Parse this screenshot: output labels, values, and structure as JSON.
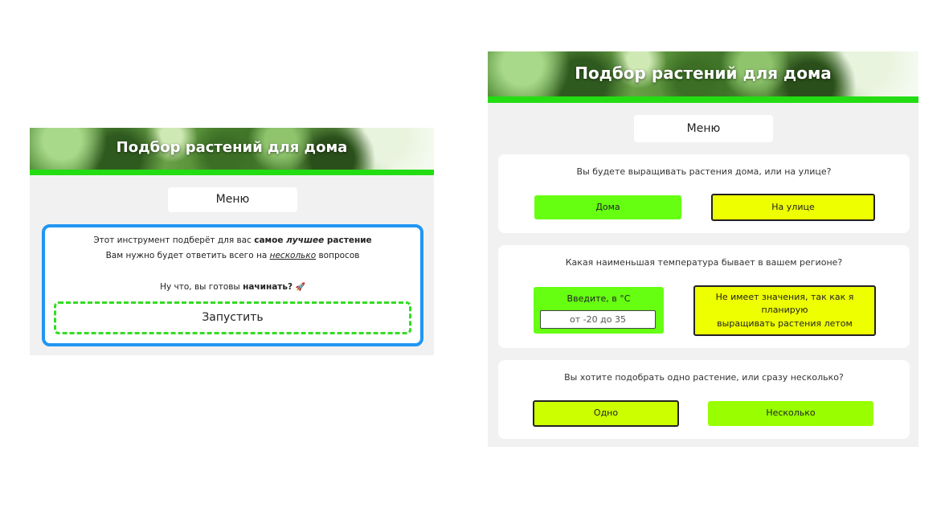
{
  "colors": {
    "accent_green": "#22dd11",
    "intro_border": "#2196f3",
    "dashed_border": "#33dd22",
    "option_green": "#66ff11",
    "option_yellow": "#eeff00",
    "option_lime": "#99ff00",
    "panel_bg": "#f1f1f1"
  },
  "left": {
    "banner_title": "Подбор растений для дома",
    "menu_label": "Меню",
    "intro": {
      "line1_prefix": "Этот инструмент подберёт для вас ",
      "line1_bold": "самое ",
      "line1_bold_italic": "лучшее",
      "line1_bold_suffix": " растение",
      "line2_prefix": "Вам нужно будет ответить всего на ",
      "line2_underlined": "несколько",
      "line2_suffix": " вопросов",
      "line3_prefix": "Ну что, вы готовы ",
      "line3_bold": "начинать?",
      "rocket_icon": "rocket-icon",
      "start_label": "Запустить"
    }
  },
  "right": {
    "banner_title": "Подбор растений для дома",
    "menu_label": "Меню",
    "questions": [
      {
        "text": "Вы будете выращивать растения дома, или на улице?",
        "options": [
          "Дома",
          "На улице"
        ]
      },
      {
        "text": "Какая наименьшая температура бывает в вашем регионе?",
        "input_label": "Введите, в °C",
        "input_placeholder": "от -20 до 35",
        "alt_option_line1": "Не имеет значения, так как я планирую",
        "alt_option_line2": "выращивать растения летом"
      },
      {
        "text": "Вы хотите подобрать одно растение, или сразу несколько?",
        "options": [
          "Одно",
          "Несколько"
        ]
      }
    ]
  }
}
